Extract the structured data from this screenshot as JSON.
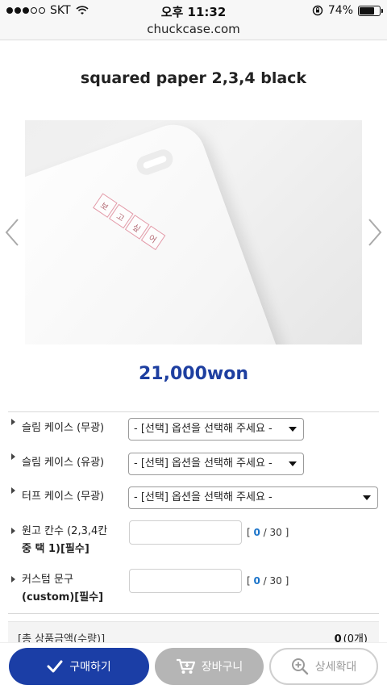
{
  "status_bar": {
    "carrier": "SKT",
    "time": "오후 11:32",
    "battery": "74%",
    "battery_level": 0.74
  },
  "url": "chuckcase.com",
  "product": {
    "title": "squared paper 2,3,4 black",
    "price": "21,000won",
    "image_grid_chars": [
      "보",
      "고",
      "싶",
      "어"
    ]
  },
  "options": [
    {
      "label": "슬림 케이스 (무광)",
      "select": "- [선택] 옵션을 선택해 주세요 -"
    },
    {
      "label": "슬림 케이스 (유광)",
      "select": "- [선택] 옵션을 선택해 주세요 -"
    },
    {
      "label": "터프 케이스 (무광)",
      "select": "- [선택] 옵션을 선택해 주세요 -"
    }
  ],
  "text_inputs": [
    {
      "label_line1": "원고 칸수 (2,3,4칸",
      "label_line2": "중 택 1)[필수]",
      "count": "0",
      "max": "30"
    },
    {
      "label_line1": "커스텀 문구",
      "label_line2": "(custom)[필수]",
      "count": "0",
      "max": "30"
    }
  ],
  "total": {
    "label": "[총 상품금액(수량)]",
    "value": "0",
    "qty": "(0개)"
  },
  "buttons": {
    "buy": "구매하기",
    "cart": "장바구니",
    "zoom": "상세확대"
  },
  "colors": {
    "accent": "#1b3ea6",
    "price": "#1e3fa0",
    "counter": "#1a73c9"
  }
}
